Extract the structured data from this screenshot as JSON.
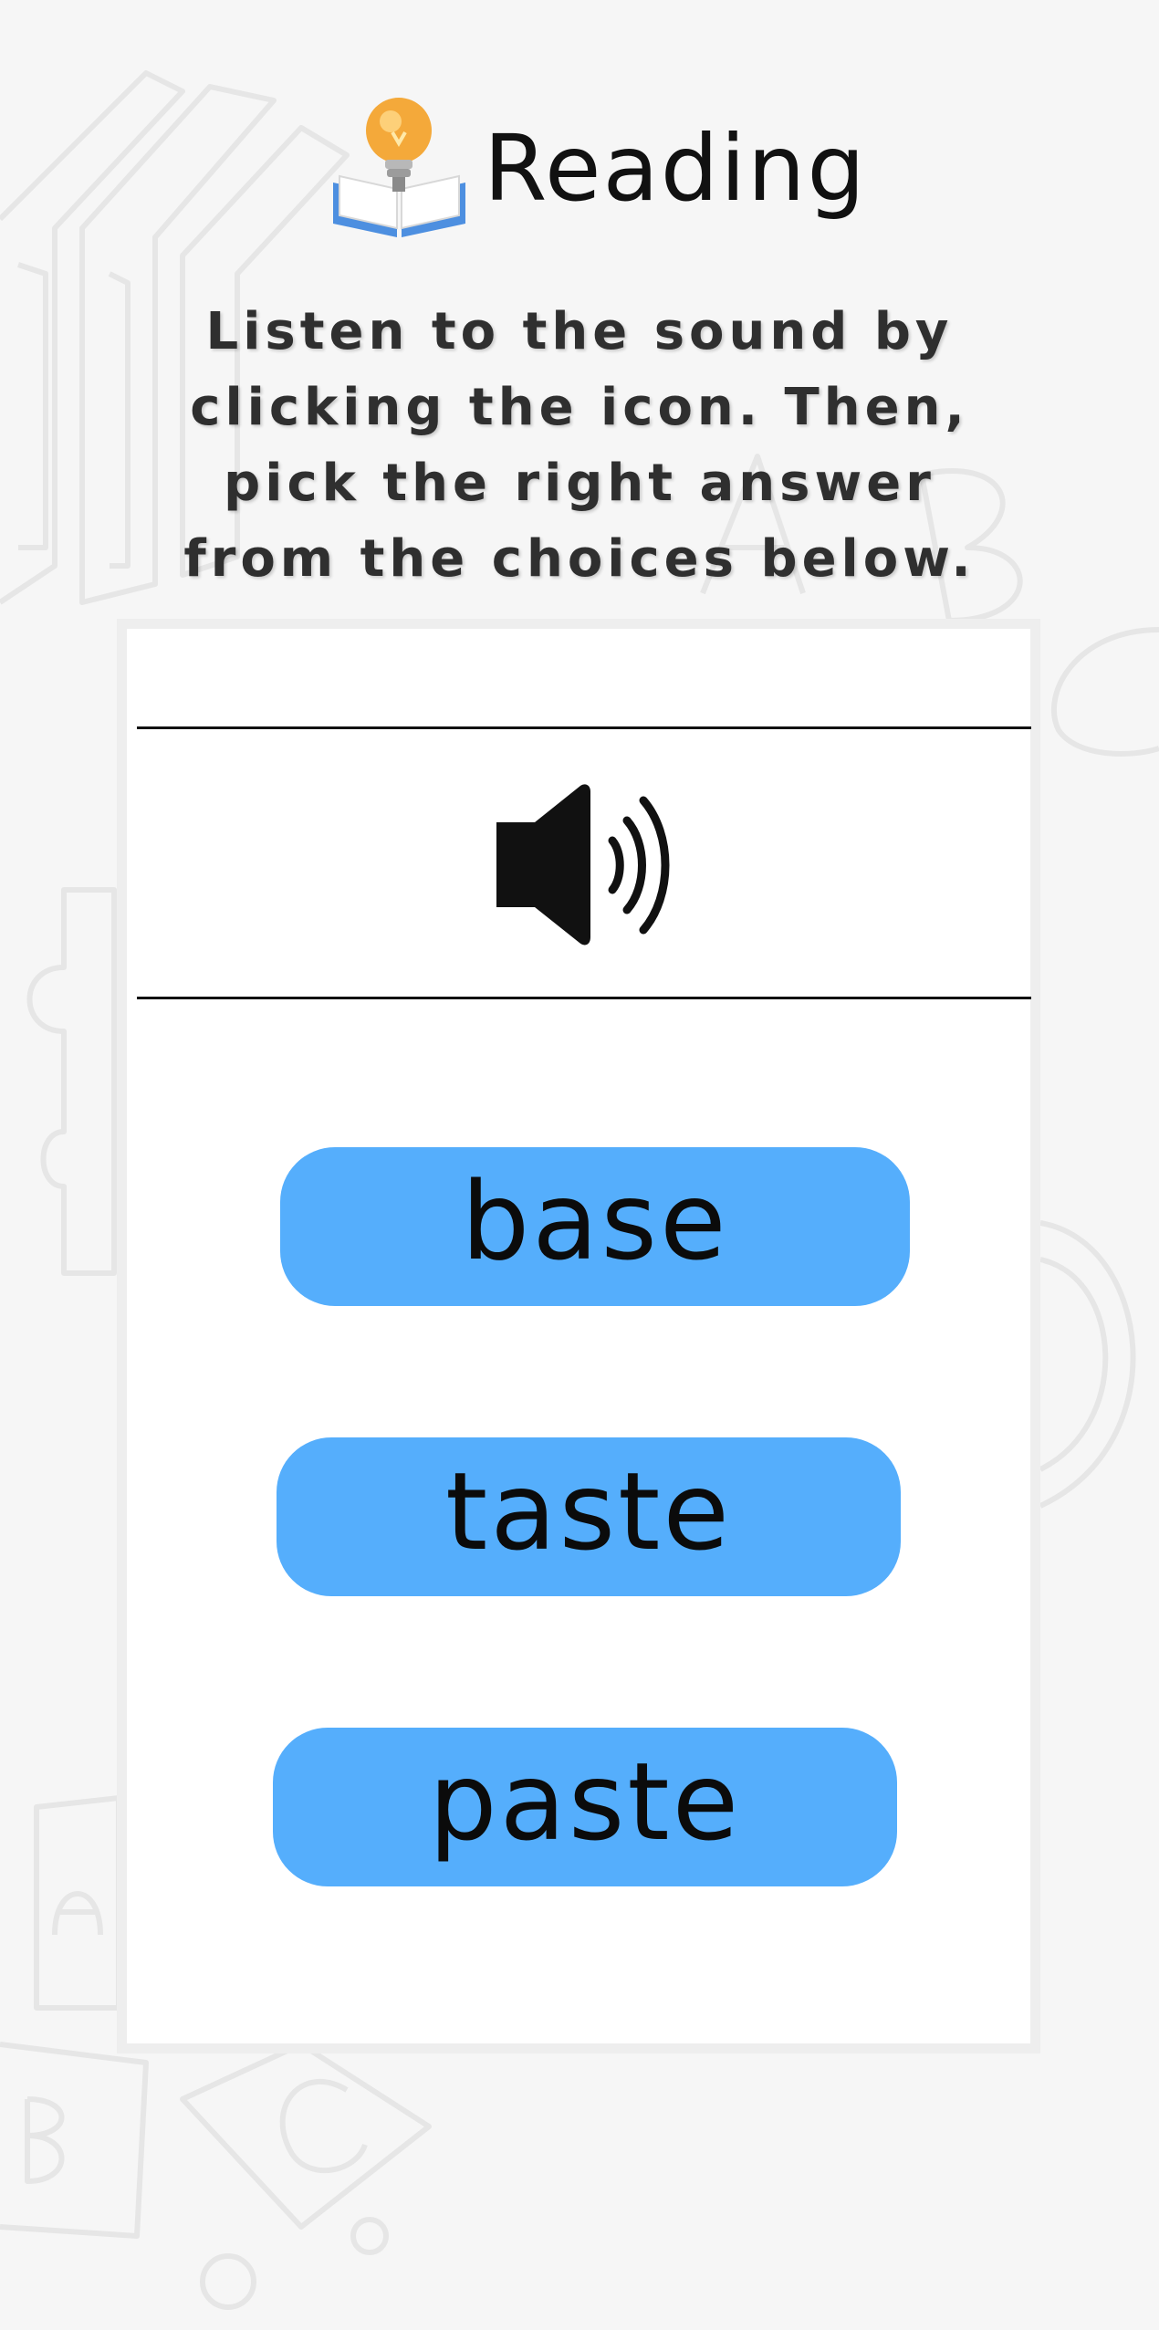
{
  "header": {
    "title": "Reading",
    "icon": "lightbulb-book-icon"
  },
  "instructions": "Listen to the sound by clicking the icon. Then, pick the right answer from the choices below.",
  "audio": {
    "icon": "speaker-icon"
  },
  "choices": [
    {
      "label": "base"
    },
    {
      "label": "taste"
    },
    {
      "label": "paste"
    }
  ],
  "colors": {
    "background": "#f6f6f6",
    "card": "#ffffff",
    "choice_button": "#55aefc",
    "text": "#111111"
  }
}
